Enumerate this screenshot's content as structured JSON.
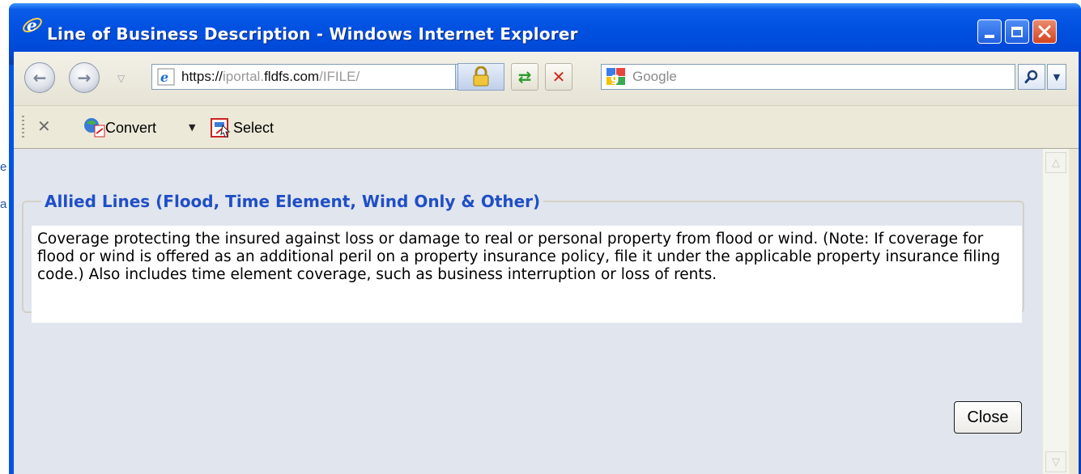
{
  "background_fragments": [
    "e",
    "a"
  ],
  "window": {
    "title": "Line of Business Description - Windows Internet Explorer",
    "controls": {
      "minimize": "minimize",
      "maximize": "maximize",
      "close": "close"
    }
  },
  "addressbar": {
    "url_scheme": "https://",
    "url_sub": "iportal.",
    "url_domain": "fldfs.com",
    "url_path": "/IFILE/",
    "search_placeholder": "Google"
  },
  "linksbar": {
    "convert_label": "Convert",
    "select_label": "Select"
  },
  "content": {
    "group_title": "Allied Lines (Flood, Time Element, Wind Only & Other)",
    "description": "Coverage protecting the insured against loss or damage to real or personal property from flood or wind. (Note: If coverage for flood or wind is offered as an additional peril on a property insurance policy, file it under the applicable property insurance filing code.) Also includes time element coverage, such as business interruption or loss of rents.",
    "close_label": "Close"
  },
  "colors": {
    "titlebar": "#0050e0",
    "legend_text": "#1f4fc6",
    "content_bg": "#e1e5ed"
  }
}
